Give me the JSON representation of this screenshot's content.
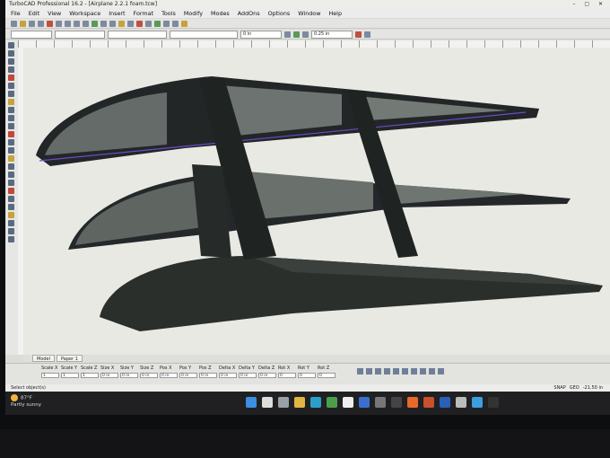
{
  "window": {
    "title": "TurboCAD Professional 16.2 - [Airplane 2.2.1 foam.tcw]"
  },
  "menu": [
    "File",
    "Edit",
    "View",
    "Workspace",
    "Insert",
    "Format",
    "Tools",
    "Modify",
    "Modes",
    "AddOns",
    "Options",
    "Window",
    "Help"
  ],
  "toolbar": {
    "units_1": "0 in",
    "units_2": "0.25 in"
  },
  "tabs": [
    "Model",
    "Paper 1"
  ],
  "properties": {
    "labels": [
      "Scale X",
      "Scale Y",
      "Scale Z",
      "Size X",
      "Size Y",
      "Size Z",
      "Pos X",
      "Pos Y",
      "Pos Z",
      "Delta X",
      "Delta Y",
      "Delta Z",
      "Rot X",
      "Rot Y",
      "Rot Z"
    ],
    "values": [
      "1",
      "1",
      "1",
      "0 in",
      "0 in",
      "0 in",
      "0 in",
      "0 in",
      "0 in",
      "0 in",
      "0 in",
      "0 in",
      "0",
      "0",
      "0"
    ]
  },
  "status": {
    "message": "Select object(s)",
    "snap": "SNAP",
    "geo": "GEO",
    "zoom": "-21.50 in"
  },
  "weather": {
    "temp": "87°F",
    "condition": "Partly sunny"
  },
  "taskbar_icons": [
    {
      "name": "start-icon",
      "color": "#3b8fe0"
    },
    {
      "name": "search-icon",
      "color": "#dddddd"
    },
    {
      "name": "task-view-icon",
      "color": "#9aa0a8"
    },
    {
      "name": "files-icon",
      "color": "#e0b640"
    },
    {
      "name": "edge-icon",
      "color": "#2aa0c8"
    },
    {
      "name": "chrome-icon",
      "color": "#4a9f4a"
    },
    {
      "name": "calendar-icon",
      "color": "#eeeeee"
    },
    {
      "name": "app-icon",
      "color": "#3a6fd0"
    },
    {
      "name": "app-x-icon",
      "color": "#777777"
    },
    {
      "name": "app-dark-icon",
      "color": "#444444"
    },
    {
      "name": "firefox-icon",
      "color": "#e86a2a"
    },
    {
      "name": "powerpoint-icon",
      "color": "#c8502a"
    },
    {
      "name": "word-icon",
      "color": "#2a5fb8"
    },
    {
      "name": "settings-icon",
      "color": "#bbbbbb"
    },
    {
      "name": "c-app-icon",
      "color": "#3aa0e0"
    },
    {
      "name": "terminal-icon",
      "color": "#333333"
    }
  ]
}
